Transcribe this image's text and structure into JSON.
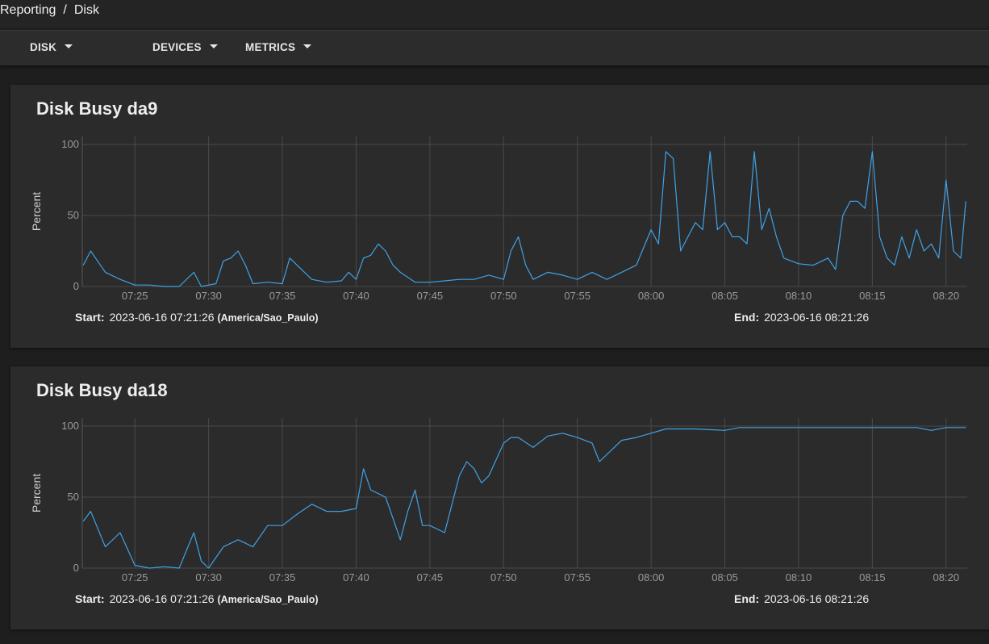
{
  "breadcrumb": {
    "root": "Reporting",
    "separator": "/",
    "current": "Disk"
  },
  "toolbar": {
    "menus": [
      {
        "label": "DISK"
      },
      {
        "label": "DEVICES"
      },
      {
        "label": "METRICS"
      }
    ]
  },
  "colors": {
    "line": "#3fa2e6",
    "grid": "#4a4a4a",
    "card": "#2b2b2b"
  },
  "cards": [
    {
      "title": "Disk Busy da9",
      "start_label": "Start:",
      "start_value": "2023-06-16 07:21:26",
      "timezone": "(America/Sao_Paulo)",
      "end_label": "End:",
      "end_value": "2023-06-16 08:21:26"
    },
    {
      "title": "Disk Busy da18",
      "start_label": "Start:",
      "start_value": "2023-06-16 07:21:26",
      "timezone": "(America/Sao_Paulo)",
      "end_label": "End:",
      "end_value": "2023-06-16 08:21:26"
    }
  ],
  "chart_data": [
    {
      "type": "line",
      "title": "Disk Busy da9",
      "xlabel": "",
      "ylabel": "Percent",
      "xlim": [
        "07:21:26",
        "08:21:26"
      ],
      "ylim": [
        0,
        100
      ],
      "xticks": [
        "07:25",
        "07:30",
        "07:35",
        "07:40",
        "07:45",
        "07:50",
        "07:55",
        "08:00",
        "08:05",
        "08:10",
        "08:15",
        "08:20"
      ],
      "yticks": [
        0,
        50,
        100
      ],
      "grid": true,
      "x": [
        "07:21:30",
        "07:22:00",
        "07:23:00",
        "07:24:00",
        "07:25:00",
        "07:26:00",
        "07:27:00",
        "07:28:00",
        "07:29:00",
        "07:29:30",
        "07:30:00",
        "07:30:30",
        "07:31:00",
        "07:31:30",
        "07:32:00",
        "07:32:30",
        "07:33:00",
        "07:34:00",
        "07:35:00",
        "07:35:30",
        "07:36:00",
        "07:37:00",
        "07:38:00",
        "07:39:00",
        "07:39:30",
        "07:40:00",
        "07:40:30",
        "07:41:00",
        "07:41:30",
        "07:42:00",
        "07:42:30",
        "07:43:00",
        "07:44:00",
        "07:45:00",
        "07:46:00",
        "07:47:00",
        "07:48:00",
        "07:49:00",
        "07:50:00",
        "07:50:30",
        "07:51:00",
        "07:51:30",
        "07:52:00",
        "07:53:00",
        "07:54:00",
        "07:55:00",
        "07:56:00",
        "07:57:00",
        "07:58:00",
        "07:59:00",
        "08:00:00",
        "08:00:30",
        "08:01:00",
        "08:01:30",
        "08:02:00",
        "08:02:30",
        "08:03:00",
        "08:03:30",
        "08:04:00",
        "08:04:30",
        "08:05:00",
        "08:05:30",
        "08:06:00",
        "08:06:30",
        "08:07:00",
        "08:07:30",
        "08:08:00",
        "08:08:30",
        "08:09:00",
        "08:09:30",
        "08:10:00",
        "08:11:00",
        "08:12:00",
        "08:12:30",
        "08:13:00",
        "08:13:30",
        "08:14:00",
        "08:14:30",
        "08:15:00",
        "08:15:30",
        "08:16:00",
        "08:16:30",
        "08:17:00",
        "08:17:30",
        "08:18:00",
        "08:18:30",
        "08:19:00",
        "08:19:30",
        "08:20:00",
        "08:20:30",
        "08:21:00",
        "08:21:20"
      ],
      "series": [
        {
          "values": [
            15,
            25,
            10,
            5,
            1,
            1,
            0,
            0,
            10,
            0,
            1,
            2,
            18,
            20,
            25,
            15,
            2,
            3,
            2,
            20,
            15,
            5,
            3,
            4,
            10,
            5,
            20,
            22,
            30,
            25,
            15,
            10,
            3,
            3,
            4,
            5,
            5,
            8,
            5,
            25,
            35,
            15,
            5,
            10,
            8,
            5,
            10,
            5,
            10,
            15,
            40,
            30,
            95,
            90,
            25,
            35,
            45,
            40,
            95,
            40,
            45,
            35,
            35,
            30,
            95,
            40,
            55,
            35,
            20,
            18,
            16,
            15,
            20,
            12,
            50,
            60,
            60,
            55,
            95,
            35,
            20,
            15,
            35,
            20,
            40,
            25,
            30,
            20,
            75,
            25,
            20,
            60
          ]
        }
      ]
    },
    {
      "type": "line",
      "title": "Disk Busy da18",
      "xlabel": "",
      "ylabel": "Percent",
      "xlim": [
        "07:21:26",
        "08:21:26"
      ],
      "ylim": [
        0,
        100
      ],
      "xticks": [
        "07:25",
        "07:30",
        "07:35",
        "07:40",
        "07:45",
        "07:50",
        "07:55",
        "08:00",
        "08:05",
        "08:10",
        "08:15",
        "08:20"
      ],
      "yticks": [
        0,
        50,
        100
      ],
      "grid": true,
      "x": [
        "07:21:30",
        "07:22:00",
        "07:23:00",
        "07:24:00",
        "07:25:00",
        "07:26:00",
        "07:27:00",
        "07:28:00",
        "07:29:00",
        "07:29:30",
        "07:30:00",
        "07:31:00",
        "07:32:00",
        "07:33:00",
        "07:34:00",
        "07:35:00",
        "07:36:00",
        "07:37:00",
        "07:38:00",
        "07:39:00",
        "07:40:00",
        "07:40:30",
        "07:41:00",
        "07:42:00",
        "07:42:30",
        "07:43:00",
        "07:43:30",
        "07:44:00",
        "07:44:30",
        "07:45:00",
        "07:46:00",
        "07:47:00",
        "07:47:30",
        "07:48:00",
        "07:48:30",
        "07:49:00",
        "07:50:00",
        "07:50:30",
        "07:51:00",
        "07:52:00",
        "07:53:00",
        "07:54:00",
        "07:55:00",
        "07:56:00",
        "07:56:30",
        "07:57:00",
        "07:58:00",
        "07:59:00",
        "08:00:00",
        "08:01:00",
        "08:02:00",
        "08:03:00",
        "08:05:00",
        "08:06:00",
        "08:07:00",
        "08:10:00",
        "08:12:00",
        "08:15:00",
        "08:18:00",
        "08:19:00",
        "08:20:00",
        "08:21:20"
      ],
      "series": [
        {
          "values": [
            33,
            40,
            15,
            25,
            2,
            0,
            1,
            0,
            25,
            5,
            0,
            15,
            20,
            15,
            30,
            30,
            38,
            45,
            40,
            40,
            42,
            70,
            55,
            50,
            35,
            20,
            40,
            55,
            30,
            30,
            25,
            65,
            75,
            70,
            60,
            65,
            88,
            92,
            92,
            85,
            93,
            95,
            92,
            88,
            75,
            80,
            90,
            92,
            95,
            98,
            98,
            98,
            97,
            99,
            99,
            99,
            99,
            99,
            99,
            97,
            99,
            99
          ]
        }
      ]
    }
  ]
}
